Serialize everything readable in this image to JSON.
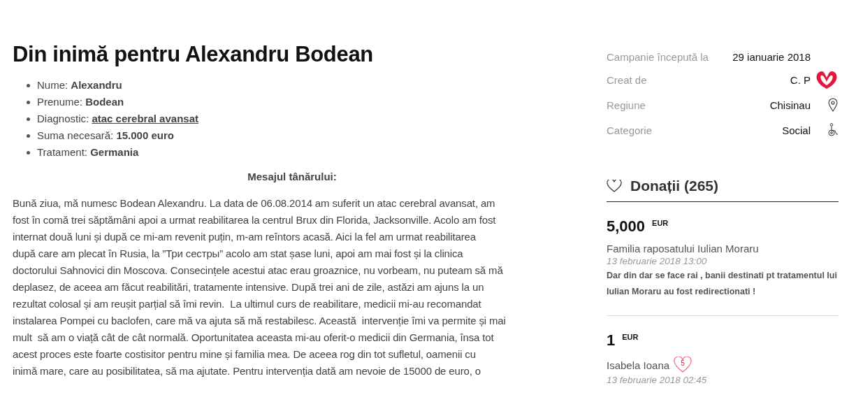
{
  "title": "Din inimă pentru Alexandru Bodean",
  "facts": [
    {
      "label": "Nume:",
      "value": "Alexandru",
      "kind": "text"
    },
    {
      "label": "Prenume:",
      "value": "Bodean",
      "kind": "text"
    },
    {
      "label": "Diagnostic:",
      "value": "atac cerebral avansat",
      "kind": "link"
    },
    {
      "label": "Suma necesară:",
      "value": "15.000 euro",
      "kind": "text"
    },
    {
      "label": "Tratament:",
      "value": "Germania",
      "kind": "text"
    }
  ],
  "message_heading": "Mesajul tânărului:",
  "message_lines": [
    "Bună ziua, mă numesc Bodean Alexandru. La data de 06.08.2014 am suferit un atac cerebral avansat, am",
    "fost în comă trei săptămâni apoi a urmat reabilitarea la centrul Brux din Florida, Jacksonville. Acolo am fost",
    "internat două luni și după ce mi-am revenit puțin, m-am reîntors acasă. Aici la fel am urmat reabilitarea",
    "după care am plecat în Rusia, la ”Три сестры” acolo am stat șase luni, apoi am mai fost și la clinica",
    "doctorului Sahnovici din Moscova. Consecințele acestui atac erau groaznice, nu vorbeam, nu puteam să mă",
    "deplasez, de aceea am făcut reabilitări, tratamente intensive. După trei ani de zile, astăzi am ajuns la un",
    "rezultat colosal și am reușit parțial să îmi revin.  La ultimul curs de reabilitare, medicii mi-au recomandat",
    "instalarea Pompei cu baclofen, care mă va ajuta să mă restabilesc. Această  intervenție îmi va permite și mai",
    "mult  să am o viață cât de cât normală. Oportunitatea aceasta mi-au oferit-o medicii din Germania, însa tot",
    "acest proces este foarte costisitor pentru mine și familia mea. De aceea rog din tot sufletul, oamenii cu",
    "inimă mare, care au posibilitatea, să ma ajutate. Pentru intervenția dată am nevoie de 15000 de euro, o"
  ],
  "campaign": [
    {
      "label": "Campanie începută la",
      "value": "29 ianuarie 2018",
      "kind": "none"
    },
    {
      "label": "Creat de",
      "value": "C. P",
      "kind": "logo"
    },
    {
      "label": "Regiune",
      "value": "Chisinau",
      "kind": "pin"
    },
    {
      "label": "Categorie",
      "value": "Social",
      "kind": "wheelchair"
    }
  ],
  "donations": {
    "heading": "Donații (265)",
    "items": [
      {
        "amount": "5,000",
        "currency": "EUR",
        "donor": "Familia raposatului Iulian Moraru",
        "date": "13 februarie 2018 13:00",
        "message": "Dar din dar se face rai , banii destinati pt tratamentul lui Iulian Moraru au fost redirectionati !"
      },
      {
        "amount": "1",
        "currency": "EUR",
        "donor": "Isabela Ioana",
        "badge": "5",
        "date": "13 februarie 2018 02:45"
      }
    ]
  }
}
